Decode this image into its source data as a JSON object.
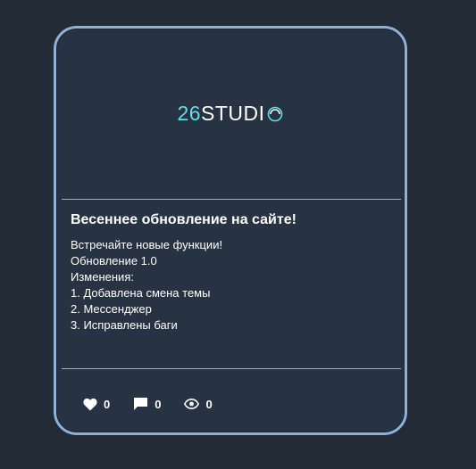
{
  "logo": {
    "number": "26",
    "text": "STUDI"
  },
  "post": {
    "title": "Весеннее обновление на сайте!",
    "lines": [
      "Встречайте новые функции!",
      "Обновление 1.0",
      "Изменения:",
      "1. Добавлена смена темы",
      "2. Мессенджер",
      "3. Исправлены баги"
    ]
  },
  "stats": {
    "likes": "0",
    "comments": "0",
    "views": "0"
  },
  "colors": {
    "background": "#222b36",
    "card": "#273342",
    "border": "#8fb0d8",
    "accent": "#5fe0e6"
  },
  "icons": {
    "like": "heart-icon",
    "comment": "comment-icon",
    "views": "eye-icon",
    "logo_o": "circle-logo-icon"
  }
}
